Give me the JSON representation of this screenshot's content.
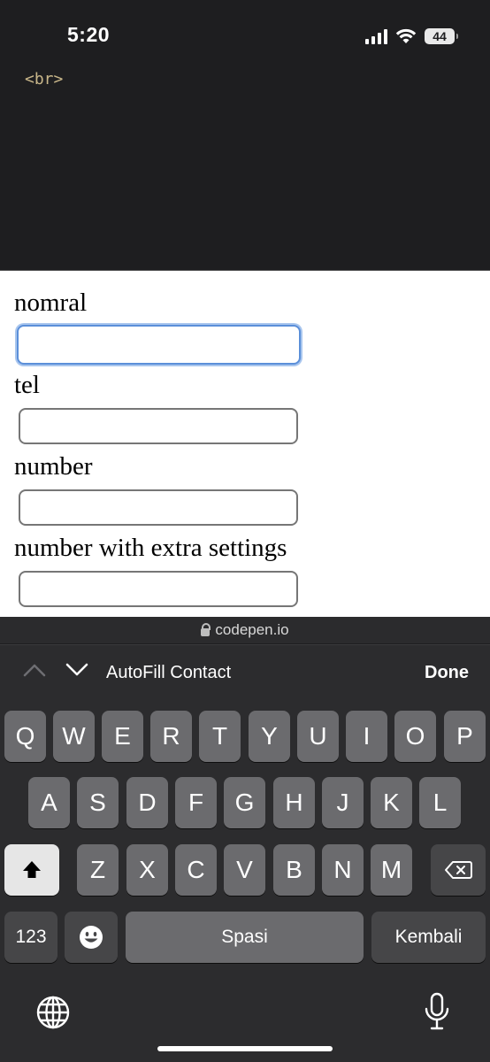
{
  "status_bar": {
    "time": "5:20",
    "battery": "44"
  },
  "code": {
    "line": "<br>"
  },
  "form": {
    "fields": [
      {
        "label": "nomral",
        "value": ""
      },
      {
        "label": "tel",
        "value": ""
      },
      {
        "label": "number",
        "value": ""
      },
      {
        "label": "number with extra settings",
        "value": ""
      }
    ]
  },
  "url_bar": {
    "domain": "codepen.io"
  },
  "accessory_bar": {
    "autofill_label": "AutoFill Contact",
    "done_label": "Done"
  },
  "keyboard": {
    "row1": [
      "Q",
      "W",
      "E",
      "R",
      "T",
      "Y",
      "U",
      "I",
      "O",
      "P"
    ],
    "row2": [
      "A",
      "S",
      "D",
      "F",
      "G",
      "H",
      "J",
      "K",
      "L"
    ],
    "row3": [
      "Z",
      "X",
      "C",
      "V",
      "B",
      "N",
      "M"
    ],
    "numbers_label": "123",
    "space_label": "Spasi",
    "return_label": "Kembali"
  },
  "colors": {
    "focus_ring": "#5b8fd9",
    "page_bg": "#ffffff",
    "keyboard_bg": "#2c2c2e"
  }
}
